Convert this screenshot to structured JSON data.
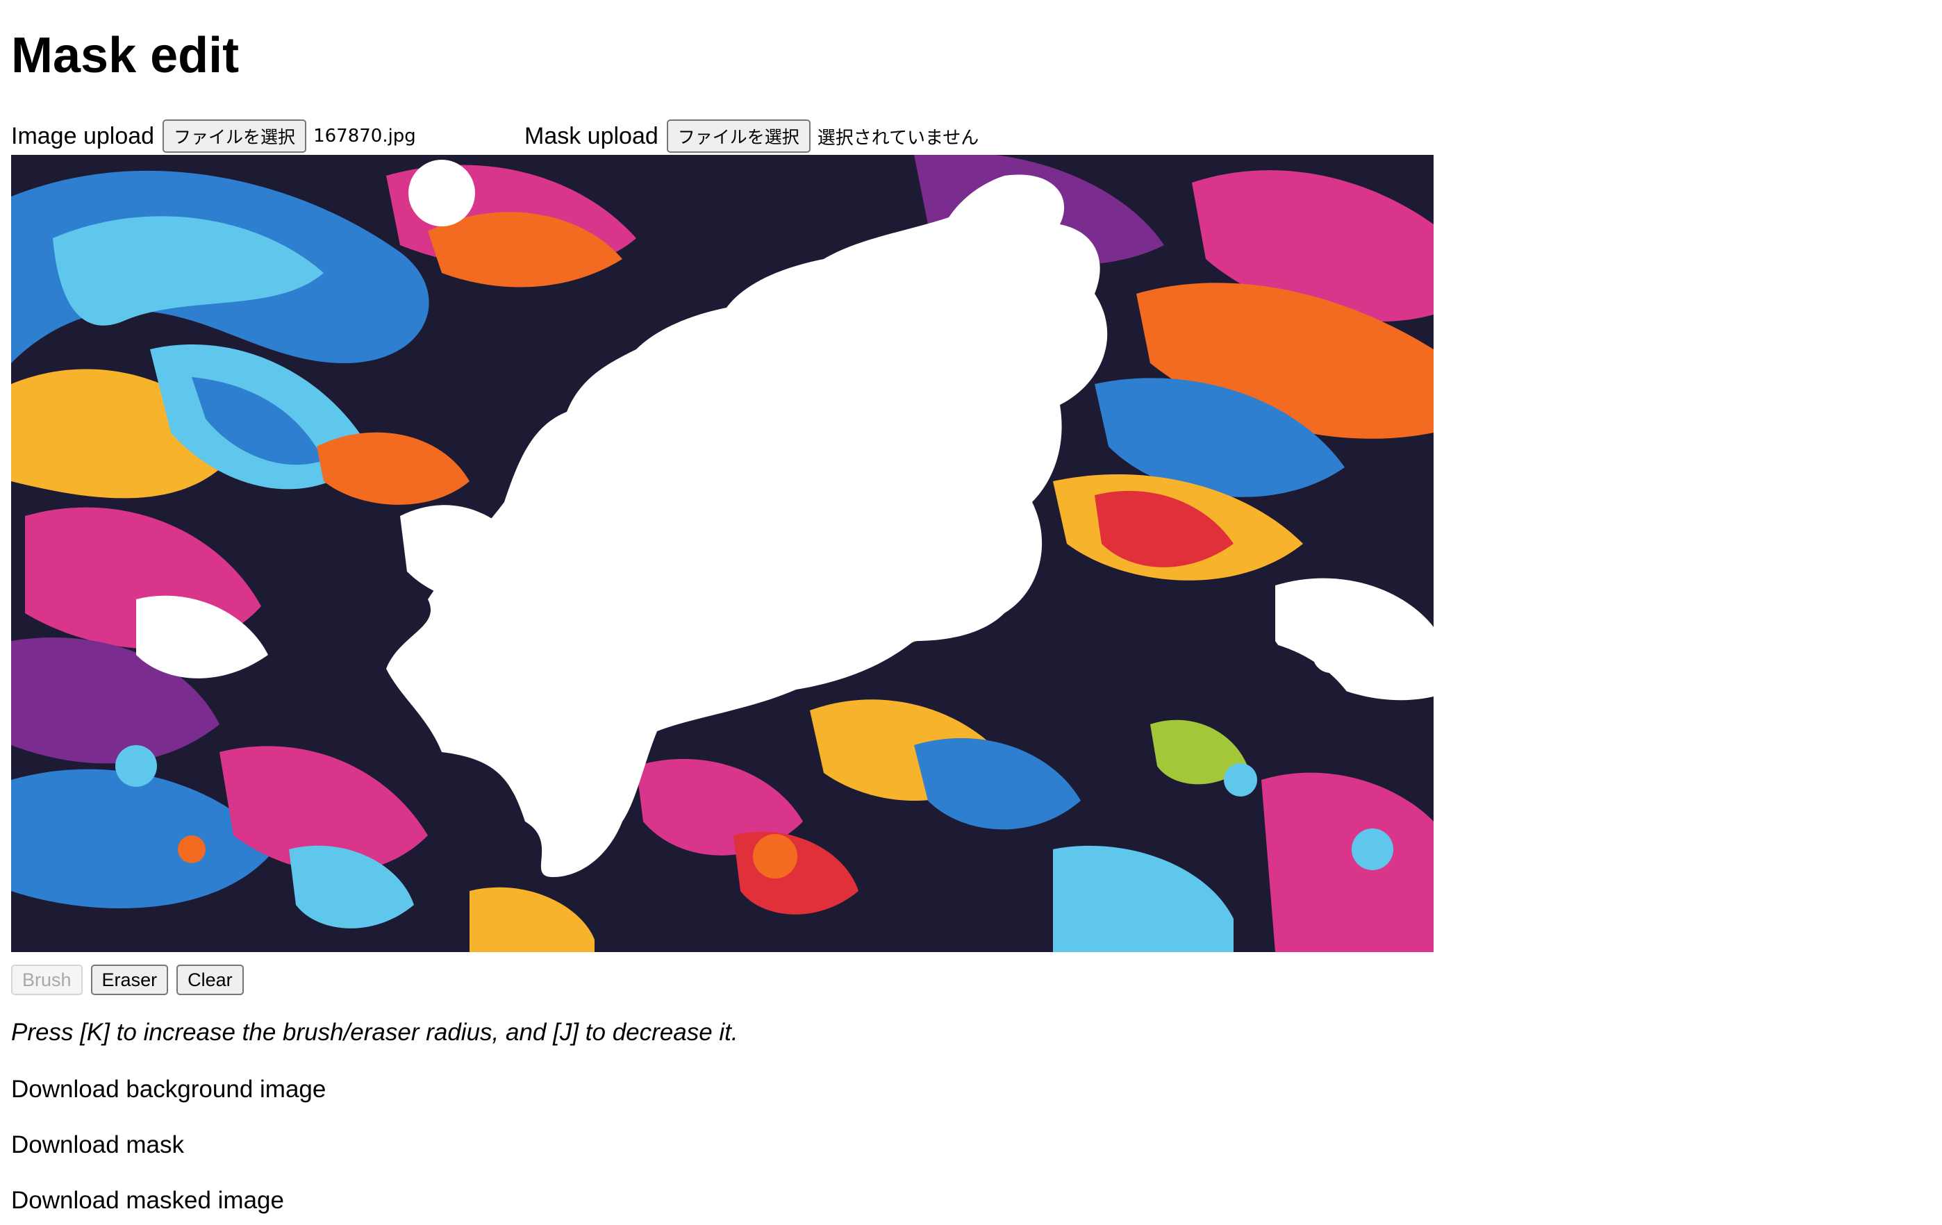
{
  "title": "Mask edit",
  "image_upload": {
    "label": "Image upload",
    "button_label": "ファイルを選択",
    "file_name": "167870.jpg"
  },
  "mask_upload": {
    "label": "Mask upload",
    "button_label": "ファイルを選択",
    "file_name": "選択されていません"
  },
  "tools": {
    "brush": "Brush",
    "eraser": "Eraser",
    "clear": "Clear",
    "active_tool": "Brush"
  },
  "hint": "Press [K] to increase the brush/eraser radius, and [J] to decrease it.",
  "downloads": {
    "background": "Download background image",
    "mask": "Download mask",
    "masked": "Download masked image"
  },
  "canvas": {
    "image_description_colors": [
      "#1d1b33",
      "#2f7fd0",
      "#5fc6ec",
      "#f26b21",
      "#f7b32b",
      "#d9368b",
      "#7b2d8f",
      "#a4c639",
      "#e0303a",
      "#ffffff"
    ],
    "mask_color": "#ffffff"
  }
}
